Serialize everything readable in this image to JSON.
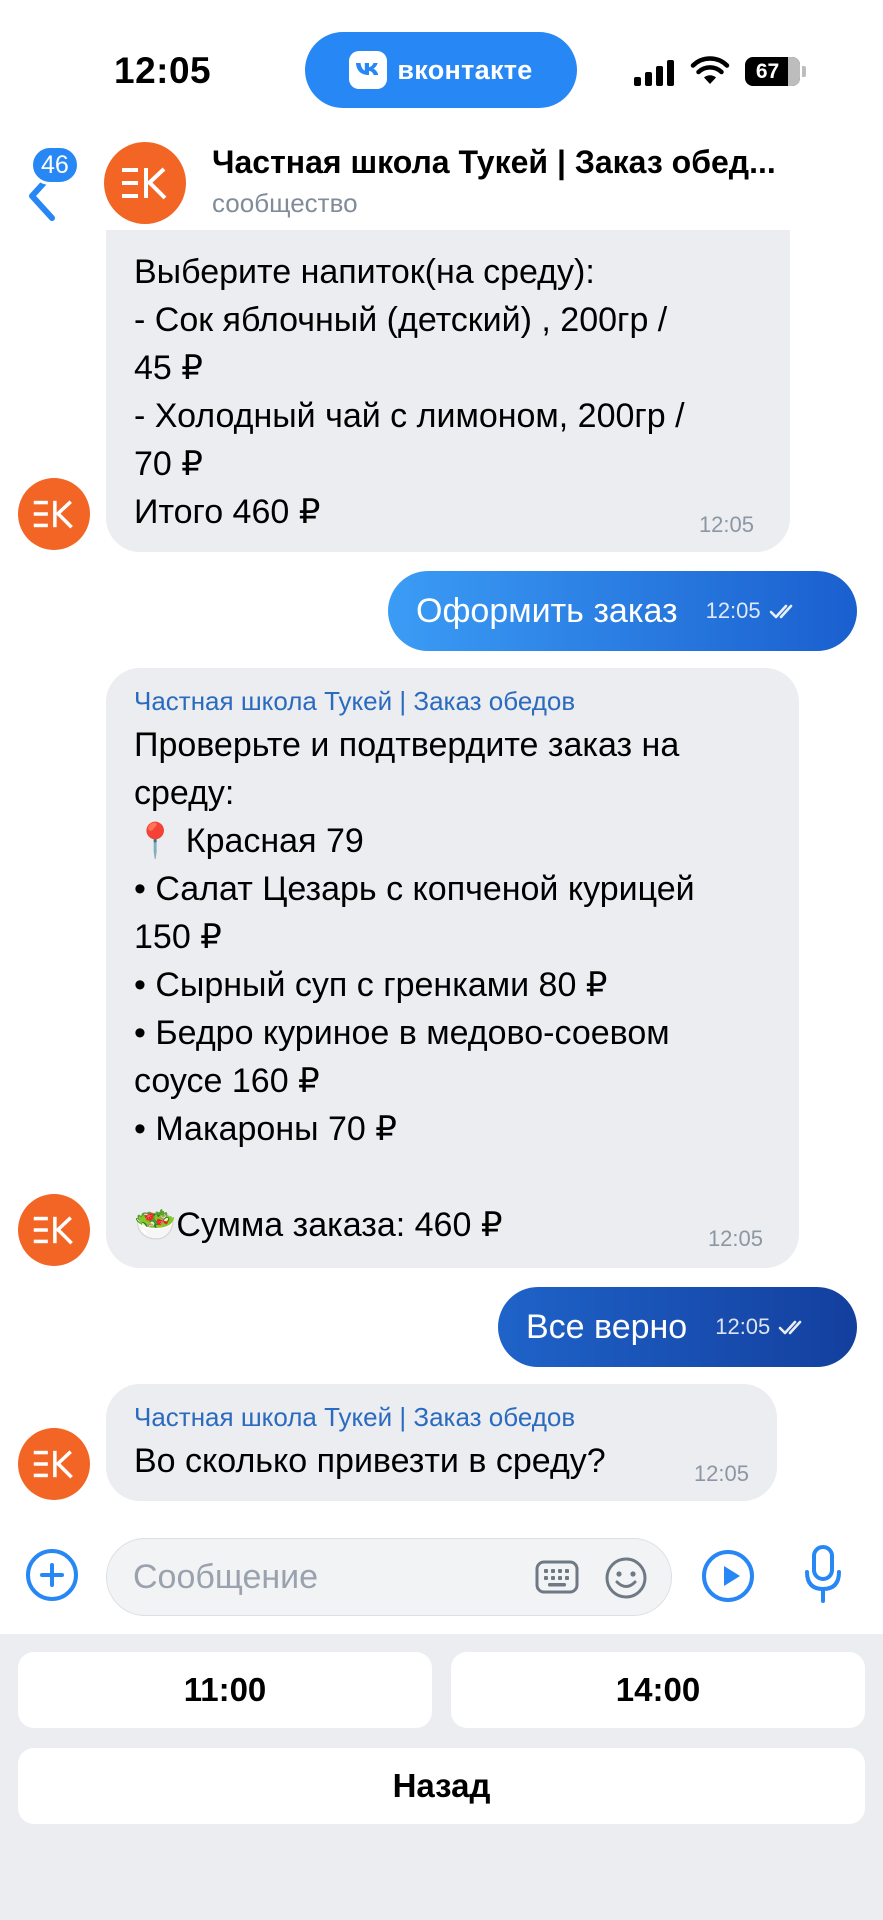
{
  "status_bar": {
    "time": "12:05",
    "app_pill": "вконтакте",
    "battery": "67"
  },
  "header": {
    "back_badge": "46",
    "title": "Частная школа Тукей | Заказ обед...",
    "subtitle": "сообщество"
  },
  "messages": [
    {
      "direction": "in",
      "lines": [
        "Выберите напиток(на среду):",
        "- Сок яблочный (детский) , 200гр /",
        "45 ₽",
        "- Холодный чай с лимоном, 200гр /",
        "70 ₽",
        "Итого 460 ₽"
      ],
      "time": "12:05"
    },
    {
      "direction": "out",
      "text": "Оформить заказ",
      "time": "12:05"
    },
    {
      "direction": "in",
      "sender": "Частная школа Тукей | Заказ обедов",
      "lines": [
        "Проверьте и подтвердите заказ на",
        "среду:",
        "📍 Красная 79",
        "• Салат Цезарь с копченой курицей",
        "150 ₽",
        "• Сырный суп с гренками 80 ₽",
        "• Бедро куриное в медово-соевом",
        "соусе 160 ₽",
        "• Макароны 70 ₽",
        "",
        "🥗Сумма заказа: 460 ₽"
      ],
      "time": "12:05"
    },
    {
      "direction": "out",
      "text": "Все верно",
      "time": "12:05"
    },
    {
      "direction": "in",
      "sender": "Частная школа Тукей | Заказ обедов",
      "lines": [
        "Во сколько привезти в среду?"
      ],
      "time": "12:05"
    }
  ],
  "composer": {
    "placeholder": "Сообщение"
  },
  "quick_replies": {
    "row1": [
      "11:00",
      "14:00"
    ],
    "back": "Назад"
  },
  "colors": {
    "accent": "#2787f5",
    "outgoing_light": "#2f8ff0",
    "outgoing_dark": "#1452b8",
    "incoming_bubble": "#ebedf0",
    "community_avatar": "#f26524",
    "sender_name": "#2b6bbf"
  }
}
